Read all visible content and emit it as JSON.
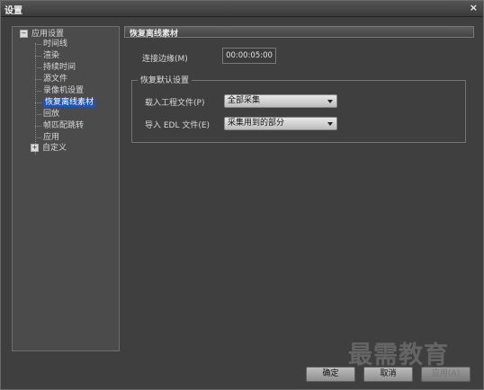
{
  "window": {
    "title": "设置",
    "close_glyph": "×"
  },
  "tree": {
    "root1": {
      "toggle": "−",
      "label": "应用设置"
    },
    "items": [
      "时间线",
      "渲染",
      "持续时间",
      "源文件",
      "录像机设置",
      "恢复离线素材",
      "回放",
      "帧匹配跳转",
      "应用"
    ],
    "selected_index": 5,
    "root2": {
      "toggle": "+",
      "label": "自定义"
    }
  },
  "panel": {
    "header": "恢复离线素材",
    "margin_label": "连接边缘(M)",
    "margin_value": "00:00:05:00",
    "group_title": "恢复默认设置",
    "load_project_label": "载入工程文件(P)",
    "load_project_value": "全部采集",
    "import_edl_label": "导入 EDL 文件(E)",
    "import_edl_value": "采集用到的部分"
  },
  "buttons": {
    "ok": "确定",
    "cancel": "取消",
    "apply": "应用(A)"
  },
  "watermark": "最需教育",
  "colors": {
    "selection": "#1f56b8",
    "background": "#3f3f3f"
  }
}
